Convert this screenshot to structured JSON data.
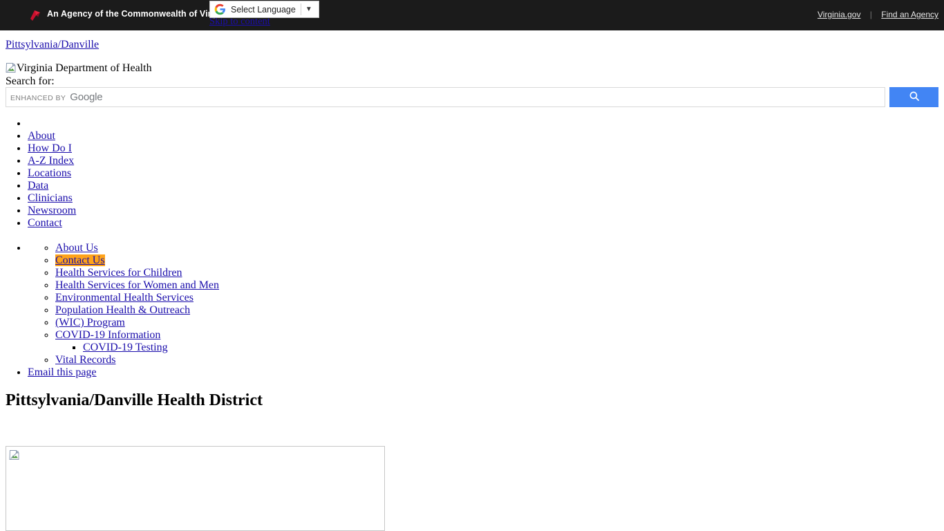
{
  "gov_bar": {
    "logo_icon": "virginia-cardinal-logo",
    "agency_text": "An Agency of the Commonwealth of Virginia",
    "virginia_gov_label": "Virginia.gov",
    "separator": "|",
    "find_agency_label": "Find an Agency",
    "background_color": "#1b1b1b"
  },
  "skip_link": {
    "label": "Skip to content"
  },
  "translate": {
    "icon": "google-g-icon",
    "label": "Select Language",
    "caret": "▼"
  },
  "breadcrumb": {
    "label": "Pittsylvania/Danville"
  },
  "site_logo": {
    "alt_text": "Virginia Department of Health",
    "icon": "broken-image-icon"
  },
  "search": {
    "label": "Search for:",
    "watermark_enhanced": "ENHANCED BY",
    "watermark_google": "Google",
    "button_icon": "search-icon",
    "button_color": "#4285f4",
    "placeholder": ""
  },
  "primary_nav": {
    "items": [
      {
        "label": ""
      },
      {
        "label": "About"
      },
      {
        "label": "How Do I"
      },
      {
        "label": "A-Z Index"
      },
      {
        "label": "Locations"
      },
      {
        "label": "Data"
      },
      {
        "label": "Clinicians"
      },
      {
        "label": "Newsroom"
      },
      {
        "label": "Contact"
      }
    ]
  },
  "secondary_nav": {
    "items": [
      {
        "label": "About Us",
        "highlighted": false
      },
      {
        "label": "Contact Us",
        "highlighted": true
      },
      {
        "label": "Health Services for Children",
        "highlighted": false
      },
      {
        "label": "Health Services for Women and Men",
        "highlighted": false
      },
      {
        "label": "Environmental Health Services",
        "highlighted": false
      },
      {
        "label": "Population Health & Outreach",
        "highlighted": false
      },
      {
        "label": "(WIC) Program",
        "highlighted": false
      },
      {
        "label": "COVID-19 Information",
        "highlighted": false
      },
      {
        "label": "Vital Records",
        "highlighted": false
      }
    ],
    "covid_child": {
      "label": "COVID-19 Testing"
    },
    "email_page_label": "Email this page",
    "highlight_color": "#ffa31a"
  },
  "main": {
    "page_title": "Pittsylvania/Danville Health District",
    "hero_image": {
      "icon": "broken-image-icon",
      "alt_text": ""
    }
  },
  "colors": {
    "link": "#1a0dab",
    "topbar_bg": "#1b1b1b",
    "google_blue": "#4285f4",
    "highlight_orange": "#ffa31a"
  }
}
